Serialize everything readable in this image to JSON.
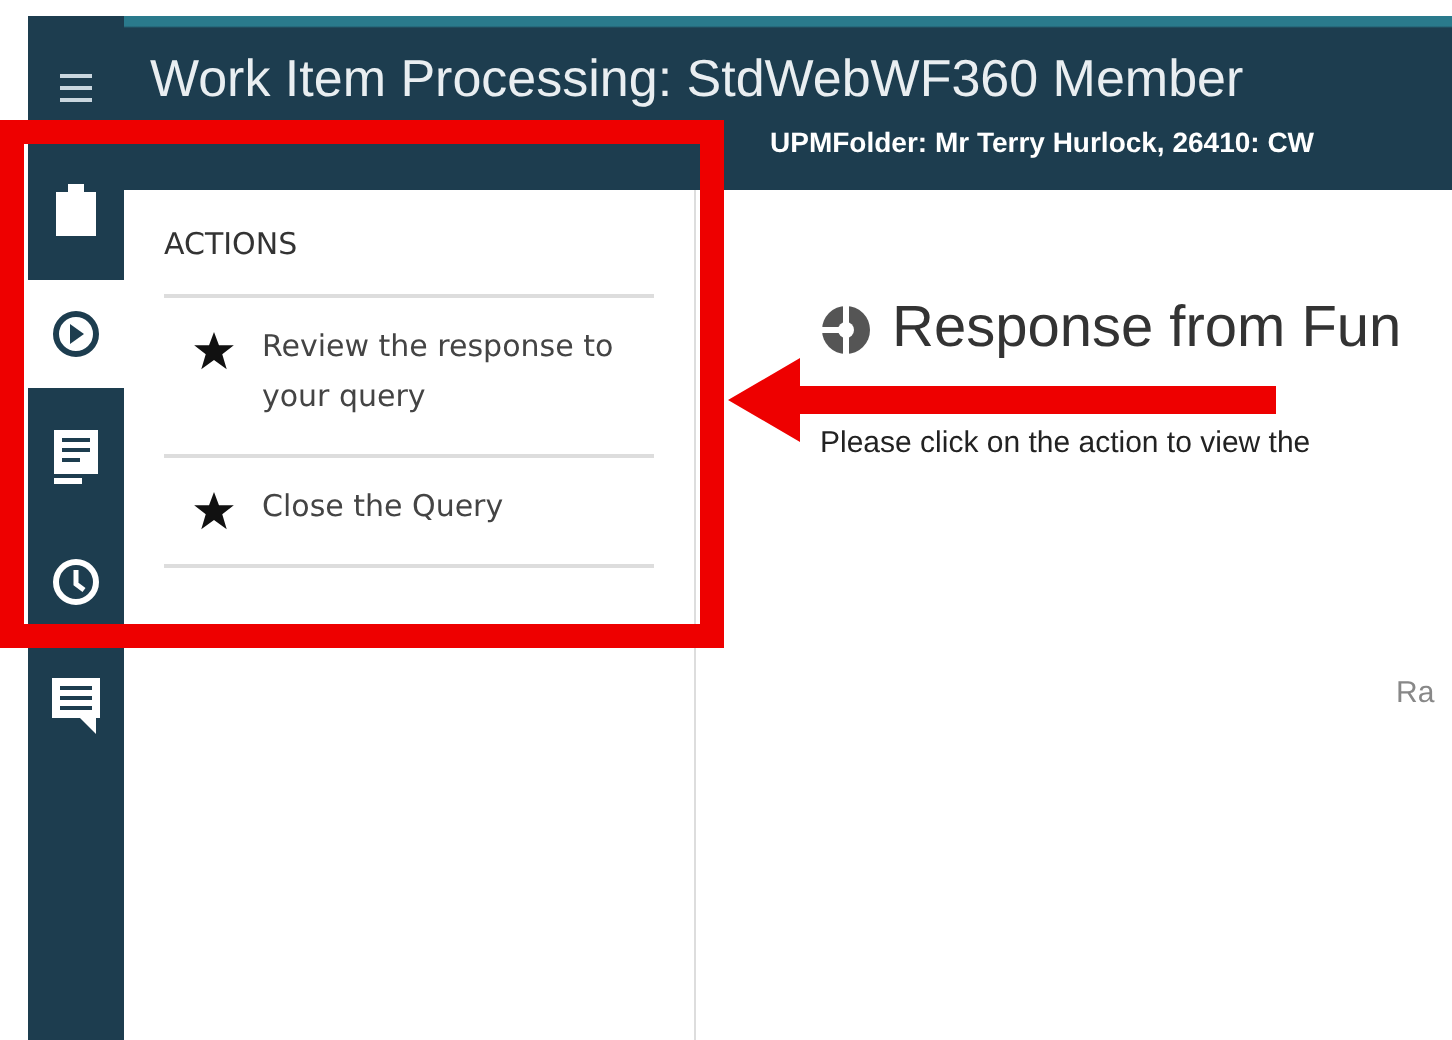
{
  "sidebar": {
    "items": [
      {
        "kind": "menu",
        "selected": false
      },
      {
        "kind": "clipboard",
        "selected": false
      },
      {
        "kind": "play",
        "selected": true
      },
      {
        "kind": "document",
        "selected": false
      },
      {
        "kind": "clock",
        "selected": false
      },
      {
        "kind": "chat",
        "selected": false
      }
    ]
  },
  "header": {
    "title": "Work Item Processing: StdWebWF360 Member",
    "subtitle": "UPMFolder: Mr Terry Hurlock, 26410: CW"
  },
  "actions": {
    "heading": "ACTIONS",
    "items": [
      {
        "label": "Review the response to your query"
      },
      {
        "label": "Close the Query"
      }
    ]
  },
  "content": {
    "heading": "Response from Fun",
    "text": "Please click on the action to view the",
    "side_text": "Ra"
  },
  "annotation": {
    "highlight_box": true,
    "arrow": true
  }
}
